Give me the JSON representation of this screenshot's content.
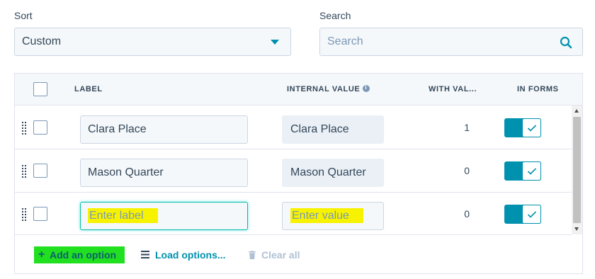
{
  "sort": {
    "label": "Sort",
    "value": "Custom"
  },
  "search": {
    "label": "Search",
    "placeholder": "Search"
  },
  "table": {
    "headers": {
      "label": "LABEL",
      "internal_value": "INTERNAL VALUE",
      "with_values": "WITH VAL...",
      "in_forms": "IN FORMS"
    },
    "rows": [
      {
        "label": "Clara Place",
        "value": "Clara Place",
        "count": "1",
        "in_forms": true
      },
      {
        "label": "Mason Quarter",
        "value": "Mason Quarter",
        "count": "0",
        "in_forms": true
      },
      {
        "label_placeholder": "Enter label",
        "value_placeholder": "Enter value",
        "count": "0",
        "in_forms": true
      }
    ]
  },
  "footer": {
    "add_option": "Add an option",
    "load_options": "Load options...",
    "clear_all": "Clear all"
  },
  "colors": {
    "accent": "#0091ae",
    "highlight_yellow": "#f7f300",
    "highlight_green": "#20e020",
    "border": "#cbd6e2"
  },
  "icons": [
    "search-icon",
    "info-icon",
    "drag-handle-icon",
    "check-icon",
    "plus-icon",
    "list-icon",
    "trash-icon"
  ]
}
